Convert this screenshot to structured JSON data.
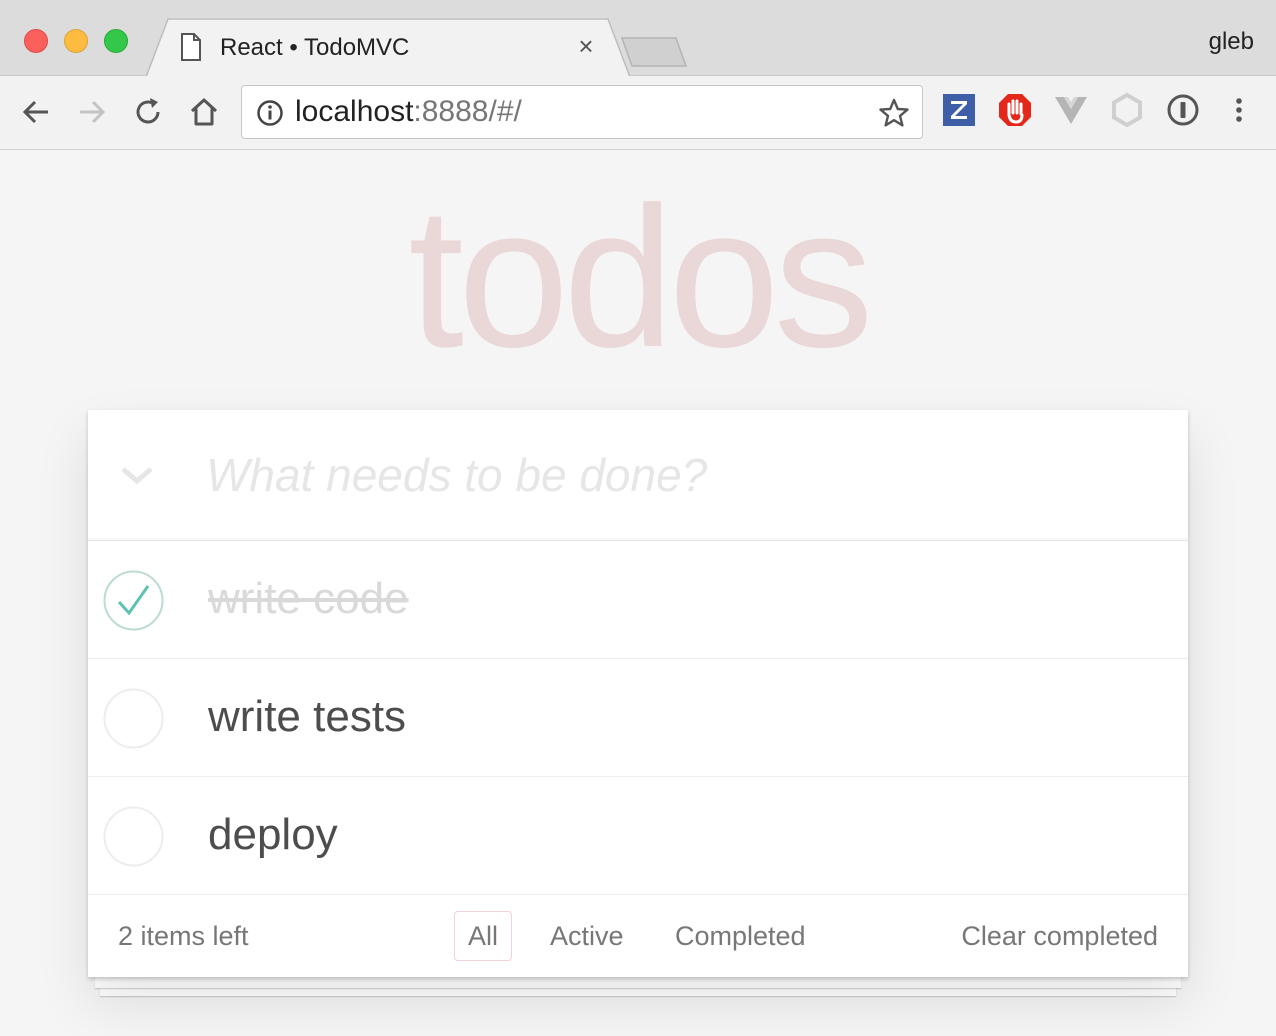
{
  "browser": {
    "tab_title": "React • TodoMVC",
    "tab_close": "×",
    "profile_name": "gleb",
    "url_host": "localhost",
    "url_rest": ":8888/#/",
    "extensions": [
      "zotero-icon",
      "adblock-icon",
      "vue-devtools-icon",
      "hexagon-extension-icon",
      "1password-icon"
    ]
  },
  "app": {
    "title": "todos",
    "new_todo_placeholder": "What needs to be done?",
    "todos": [
      {
        "label": "write code",
        "completed": true
      },
      {
        "label": "write tests",
        "completed": false
      },
      {
        "label": "deploy",
        "completed": false
      }
    ],
    "footer": {
      "items_left": "2 items left",
      "filters": [
        "All",
        "Active",
        "Completed"
      ],
      "selected_filter": "All",
      "clear_completed": "Clear completed"
    }
  },
  "colors": {
    "title": "#af2f2f",
    "check": "#5dc2af",
    "text": "#4d4d4d",
    "muted": "#777777"
  }
}
